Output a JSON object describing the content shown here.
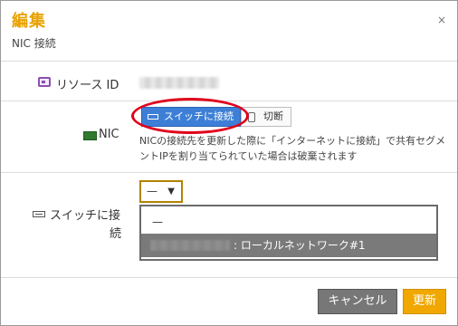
{
  "dialog": {
    "title": "編集",
    "subtitle": "NIC 接続",
    "close_glyph": "×"
  },
  "fields": {
    "resource_id_label": "リソース ID",
    "nic_label": "NIC",
    "switch_label_line1": "スイッチに接",
    "switch_label_line2": "続"
  },
  "nic": {
    "connect_switch_button": "スイッチに接続",
    "disconnect_button": "切断",
    "note": "NICの接続先を更新した際に「インターネットに接続」で共有セグメントIPを割り当てられていた場合は破棄されます"
  },
  "switch_select": {
    "selected": "—",
    "caret": "▼",
    "options": [
      {
        "label": "—"
      },
      {
        "label": ": ローカルネットワーク#1",
        "highlighted": true
      }
    ]
  },
  "footer": {
    "cancel_label": "キャンセル",
    "update_label": "更新"
  },
  "colors": {
    "title": "#e8a200",
    "primary_button": "#3d7fd6",
    "highlight_ring": "#e0001a",
    "update_button": "#f0a800",
    "cancel_button": "#777777"
  },
  "icons": {
    "resource_id": "id-card-icon",
    "nic": "nic-card-icon",
    "switch": "switch-icon",
    "disconnect": "plug-icon"
  }
}
